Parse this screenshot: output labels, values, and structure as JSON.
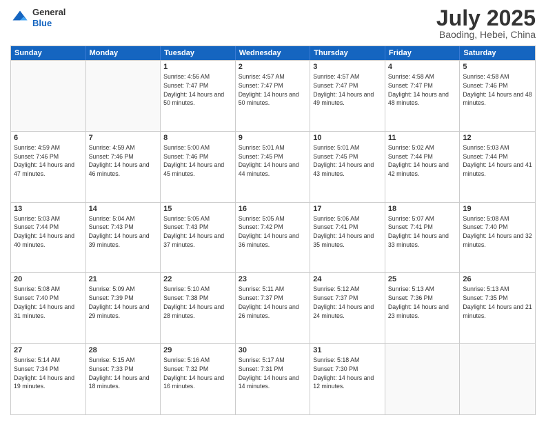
{
  "header": {
    "logo_line1": "General",
    "logo_line2": "Blue",
    "month": "July 2025",
    "location": "Baoding, Hebei, China"
  },
  "weekdays": [
    "Sunday",
    "Monday",
    "Tuesday",
    "Wednesday",
    "Thursday",
    "Friday",
    "Saturday"
  ],
  "rows": [
    [
      {
        "day": "",
        "sunrise": "",
        "sunset": "",
        "daylight": ""
      },
      {
        "day": "",
        "sunrise": "",
        "sunset": "",
        "daylight": ""
      },
      {
        "day": "1",
        "sunrise": "Sunrise: 4:56 AM",
        "sunset": "Sunset: 7:47 PM",
        "daylight": "Daylight: 14 hours and 50 minutes."
      },
      {
        "day": "2",
        "sunrise": "Sunrise: 4:57 AM",
        "sunset": "Sunset: 7:47 PM",
        "daylight": "Daylight: 14 hours and 50 minutes."
      },
      {
        "day": "3",
        "sunrise": "Sunrise: 4:57 AM",
        "sunset": "Sunset: 7:47 PM",
        "daylight": "Daylight: 14 hours and 49 minutes."
      },
      {
        "day": "4",
        "sunrise": "Sunrise: 4:58 AM",
        "sunset": "Sunset: 7:47 PM",
        "daylight": "Daylight: 14 hours and 48 minutes."
      },
      {
        "day": "5",
        "sunrise": "Sunrise: 4:58 AM",
        "sunset": "Sunset: 7:46 PM",
        "daylight": "Daylight: 14 hours and 48 minutes."
      }
    ],
    [
      {
        "day": "6",
        "sunrise": "Sunrise: 4:59 AM",
        "sunset": "Sunset: 7:46 PM",
        "daylight": "Daylight: 14 hours and 47 minutes."
      },
      {
        "day": "7",
        "sunrise": "Sunrise: 4:59 AM",
        "sunset": "Sunset: 7:46 PM",
        "daylight": "Daylight: 14 hours and 46 minutes."
      },
      {
        "day": "8",
        "sunrise": "Sunrise: 5:00 AM",
        "sunset": "Sunset: 7:46 PM",
        "daylight": "Daylight: 14 hours and 45 minutes."
      },
      {
        "day": "9",
        "sunrise": "Sunrise: 5:01 AM",
        "sunset": "Sunset: 7:45 PM",
        "daylight": "Daylight: 14 hours and 44 minutes."
      },
      {
        "day": "10",
        "sunrise": "Sunrise: 5:01 AM",
        "sunset": "Sunset: 7:45 PM",
        "daylight": "Daylight: 14 hours and 43 minutes."
      },
      {
        "day": "11",
        "sunrise": "Sunrise: 5:02 AM",
        "sunset": "Sunset: 7:44 PM",
        "daylight": "Daylight: 14 hours and 42 minutes."
      },
      {
        "day": "12",
        "sunrise": "Sunrise: 5:03 AM",
        "sunset": "Sunset: 7:44 PM",
        "daylight": "Daylight: 14 hours and 41 minutes."
      }
    ],
    [
      {
        "day": "13",
        "sunrise": "Sunrise: 5:03 AM",
        "sunset": "Sunset: 7:44 PM",
        "daylight": "Daylight: 14 hours and 40 minutes."
      },
      {
        "day": "14",
        "sunrise": "Sunrise: 5:04 AM",
        "sunset": "Sunset: 7:43 PM",
        "daylight": "Daylight: 14 hours and 39 minutes."
      },
      {
        "day": "15",
        "sunrise": "Sunrise: 5:05 AM",
        "sunset": "Sunset: 7:43 PM",
        "daylight": "Daylight: 14 hours and 37 minutes."
      },
      {
        "day": "16",
        "sunrise": "Sunrise: 5:05 AM",
        "sunset": "Sunset: 7:42 PM",
        "daylight": "Daylight: 14 hours and 36 minutes."
      },
      {
        "day": "17",
        "sunrise": "Sunrise: 5:06 AM",
        "sunset": "Sunset: 7:41 PM",
        "daylight": "Daylight: 14 hours and 35 minutes."
      },
      {
        "day": "18",
        "sunrise": "Sunrise: 5:07 AM",
        "sunset": "Sunset: 7:41 PM",
        "daylight": "Daylight: 14 hours and 33 minutes."
      },
      {
        "day": "19",
        "sunrise": "Sunrise: 5:08 AM",
        "sunset": "Sunset: 7:40 PM",
        "daylight": "Daylight: 14 hours and 32 minutes."
      }
    ],
    [
      {
        "day": "20",
        "sunrise": "Sunrise: 5:08 AM",
        "sunset": "Sunset: 7:40 PM",
        "daylight": "Daylight: 14 hours and 31 minutes."
      },
      {
        "day": "21",
        "sunrise": "Sunrise: 5:09 AM",
        "sunset": "Sunset: 7:39 PM",
        "daylight": "Daylight: 14 hours and 29 minutes."
      },
      {
        "day": "22",
        "sunrise": "Sunrise: 5:10 AM",
        "sunset": "Sunset: 7:38 PM",
        "daylight": "Daylight: 14 hours and 28 minutes."
      },
      {
        "day": "23",
        "sunrise": "Sunrise: 5:11 AM",
        "sunset": "Sunset: 7:37 PM",
        "daylight": "Daylight: 14 hours and 26 minutes."
      },
      {
        "day": "24",
        "sunrise": "Sunrise: 5:12 AM",
        "sunset": "Sunset: 7:37 PM",
        "daylight": "Daylight: 14 hours and 24 minutes."
      },
      {
        "day": "25",
        "sunrise": "Sunrise: 5:13 AM",
        "sunset": "Sunset: 7:36 PM",
        "daylight": "Daylight: 14 hours and 23 minutes."
      },
      {
        "day": "26",
        "sunrise": "Sunrise: 5:13 AM",
        "sunset": "Sunset: 7:35 PM",
        "daylight": "Daylight: 14 hours and 21 minutes."
      }
    ],
    [
      {
        "day": "27",
        "sunrise": "Sunrise: 5:14 AM",
        "sunset": "Sunset: 7:34 PM",
        "daylight": "Daylight: 14 hours and 19 minutes."
      },
      {
        "day": "28",
        "sunrise": "Sunrise: 5:15 AM",
        "sunset": "Sunset: 7:33 PM",
        "daylight": "Daylight: 14 hours and 18 minutes."
      },
      {
        "day": "29",
        "sunrise": "Sunrise: 5:16 AM",
        "sunset": "Sunset: 7:32 PM",
        "daylight": "Daylight: 14 hours and 16 minutes."
      },
      {
        "day": "30",
        "sunrise": "Sunrise: 5:17 AM",
        "sunset": "Sunset: 7:31 PM",
        "daylight": "Daylight: 14 hours and 14 minutes."
      },
      {
        "day": "31",
        "sunrise": "Sunrise: 5:18 AM",
        "sunset": "Sunset: 7:30 PM",
        "daylight": "Daylight: 14 hours and 12 minutes."
      },
      {
        "day": "",
        "sunrise": "",
        "sunset": "",
        "daylight": ""
      },
      {
        "day": "",
        "sunrise": "",
        "sunset": "",
        "daylight": ""
      }
    ]
  ]
}
